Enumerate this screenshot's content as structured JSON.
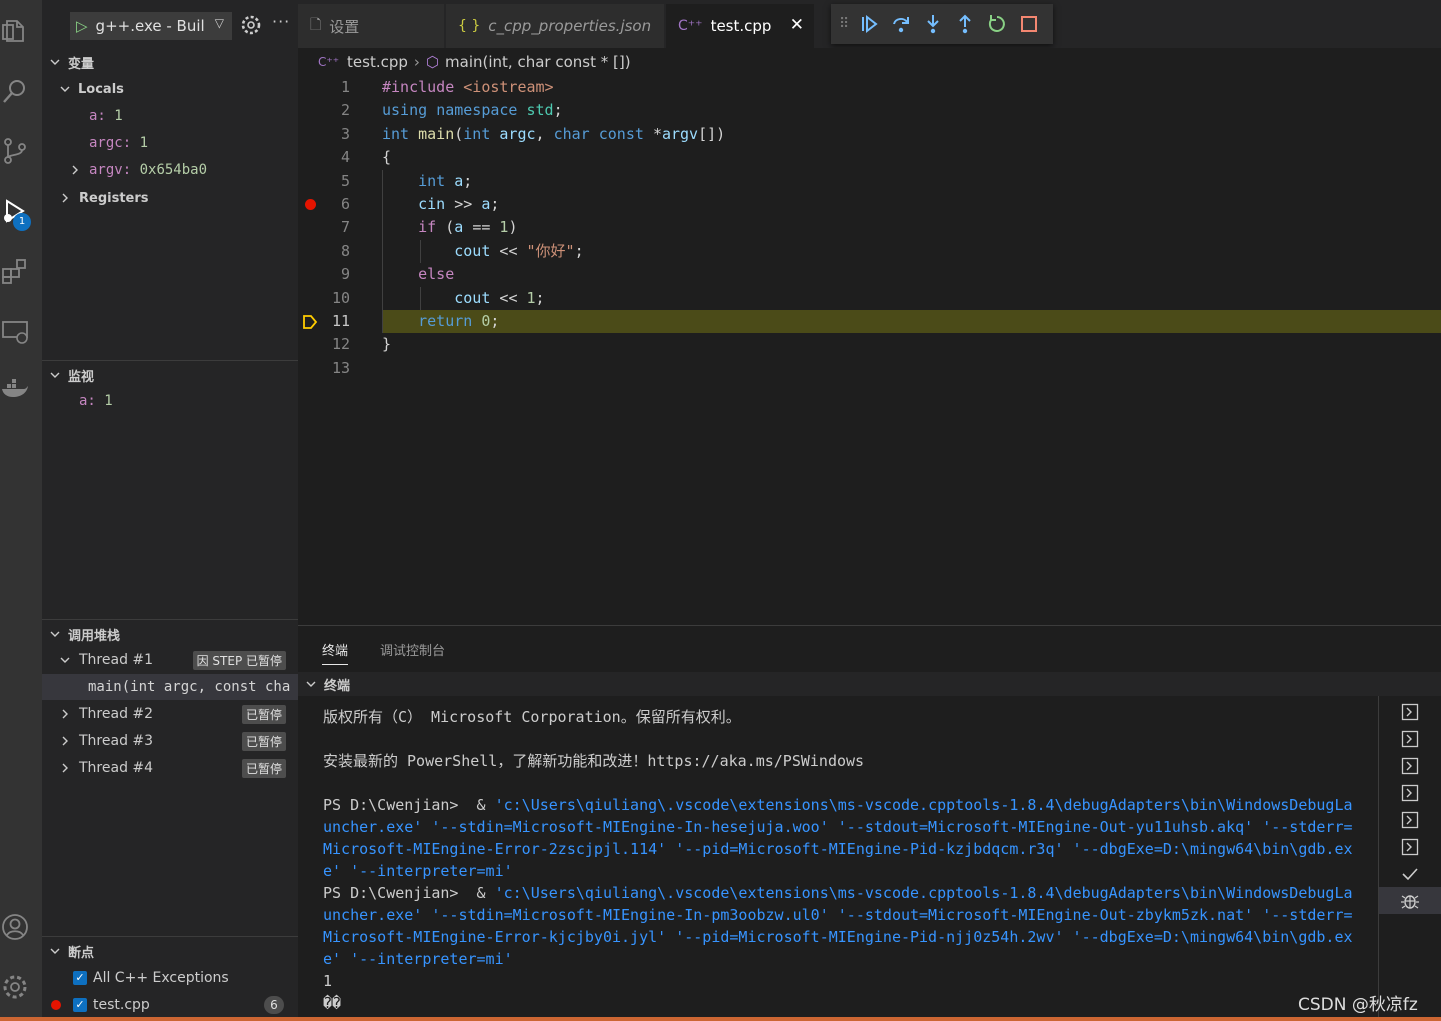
{
  "activity_bar": {
    "debug_badge": "1"
  },
  "sidebar": {
    "launch_config": "g++.exe - Buil",
    "variables": {
      "header": "变量",
      "locals_label": "Locals",
      "locals": [
        {
          "name": "a:",
          "value": "1"
        },
        {
          "name": "argc:",
          "value": "1"
        },
        {
          "name": "argv:",
          "value": "0x654ba0"
        }
      ],
      "registers_label": "Registers"
    },
    "watch": {
      "header": "监视",
      "items": [
        {
          "name": "a:",
          "value": "1"
        }
      ]
    },
    "call_stack": {
      "header": "调用堆栈",
      "threads": [
        {
          "label": "Thread #1",
          "status": "因 STEP 已暂停"
        },
        {
          "label": "Thread #2",
          "status": "已暂停"
        },
        {
          "label": "Thread #3",
          "status": "已暂停"
        },
        {
          "label": "Thread #4",
          "status": "已暂停"
        }
      ],
      "frame": "main(int argc, const cha"
    },
    "breakpoints": {
      "header": "断点",
      "items": [
        {
          "label": "All C++ Exceptions",
          "count": ""
        },
        {
          "label": "test.cpp",
          "count": "6"
        }
      ]
    }
  },
  "tabs": [
    {
      "label": "设置",
      "icon": "file-icon"
    },
    {
      "label": "c_cpp_properties.json",
      "icon": "json-braces-icon"
    },
    {
      "label": "test.cpp",
      "icon": "cpp-icon"
    }
  ],
  "breadcrumb": {
    "file": "test.cpp",
    "symbol": "main(int, char const * [])"
  },
  "code": {
    "line_numbers": [
      "1",
      "2",
      "3",
      "4",
      "5",
      "6",
      "7",
      "8",
      "9",
      "10",
      "11",
      "12",
      "13"
    ],
    "lines": [
      "#include <iostream>",
      "using namespace std;",
      "int main(int argc, char const *argv[])",
      "{",
      "    int a;",
      "    cin >> a;",
      "    if (a == 1)",
      "        cout << \"你好\";",
      "    else",
      "        cout << 1;",
      "    return 0;",
      "}",
      ""
    ],
    "breakpoint_line": 6,
    "current_line": 11
  },
  "panel": {
    "tabs": [
      "终端",
      "调试控制台"
    ],
    "terminal_header": "终端",
    "terminal_lines": [
      {
        "text": "版权所有（C） Microsoft Corporation。保留所有权利。"
      },
      {
        "text": ""
      },
      {
        "text": "安装最新的 PowerShell，了解新功能和改进！https://aka.ms/PSWindows"
      },
      {
        "text": ""
      },
      {
        "prompt": "PS D:\\Cwenjian>  & ",
        "cmd": "'c:\\Users\\qiuliang\\.vscode\\extensions\\ms-vscode.cpptools-1.8.4\\debugAdapters\\bin\\WindowsDebugLauncher.exe' '--stdin=Microsoft-MIEngine-In-hesejuja.woo' '--stdout=Microsoft-MIEngine-Out-yu11uhsb.akq' '--stderr=Microsoft-MIEngine-Error-2zscjpjl.114' '--pid=Microsoft-MIEngine-Pid-kzjbdqcm.r3q' '--dbgExe=D:\\mingw64\\bin\\gdb.exe' '--interpreter=mi'"
      },
      {
        "prompt": "PS D:\\Cwenjian>  & ",
        "cmd": "'c:\\Users\\qiuliang\\.vscode\\extensions\\ms-vscode.cpptools-1.8.4\\debugAdapters\\bin\\WindowsDebugLauncher.exe' '--stdin=Microsoft-MIEngine-In-pm3oobzw.ul0' '--stdout=Microsoft-MIEngine-Out-zbykm5zk.nat' '--stderr=Microsoft-MIEngine-Error-kjcjby0i.jyl' '--pid=Microsoft-MIEngine-Pid-njj0z54h.2wv' '--dbgExe=D:\\mingw64\\bin\\gdb.exe' '--interpreter=mi'"
      },
      {
        "text": "1"
      },
      {
        "text": "��"
      }
    ]
  },
  "watermark": "CSDN @秋凉fz",
  "colors": {
    "accent": "#0e70c0",
    "breakpoint": "#e51400",
    "current_line_bg": "#4b4b18",
    "debug_arrow": "#ffcc00"
  }
}
